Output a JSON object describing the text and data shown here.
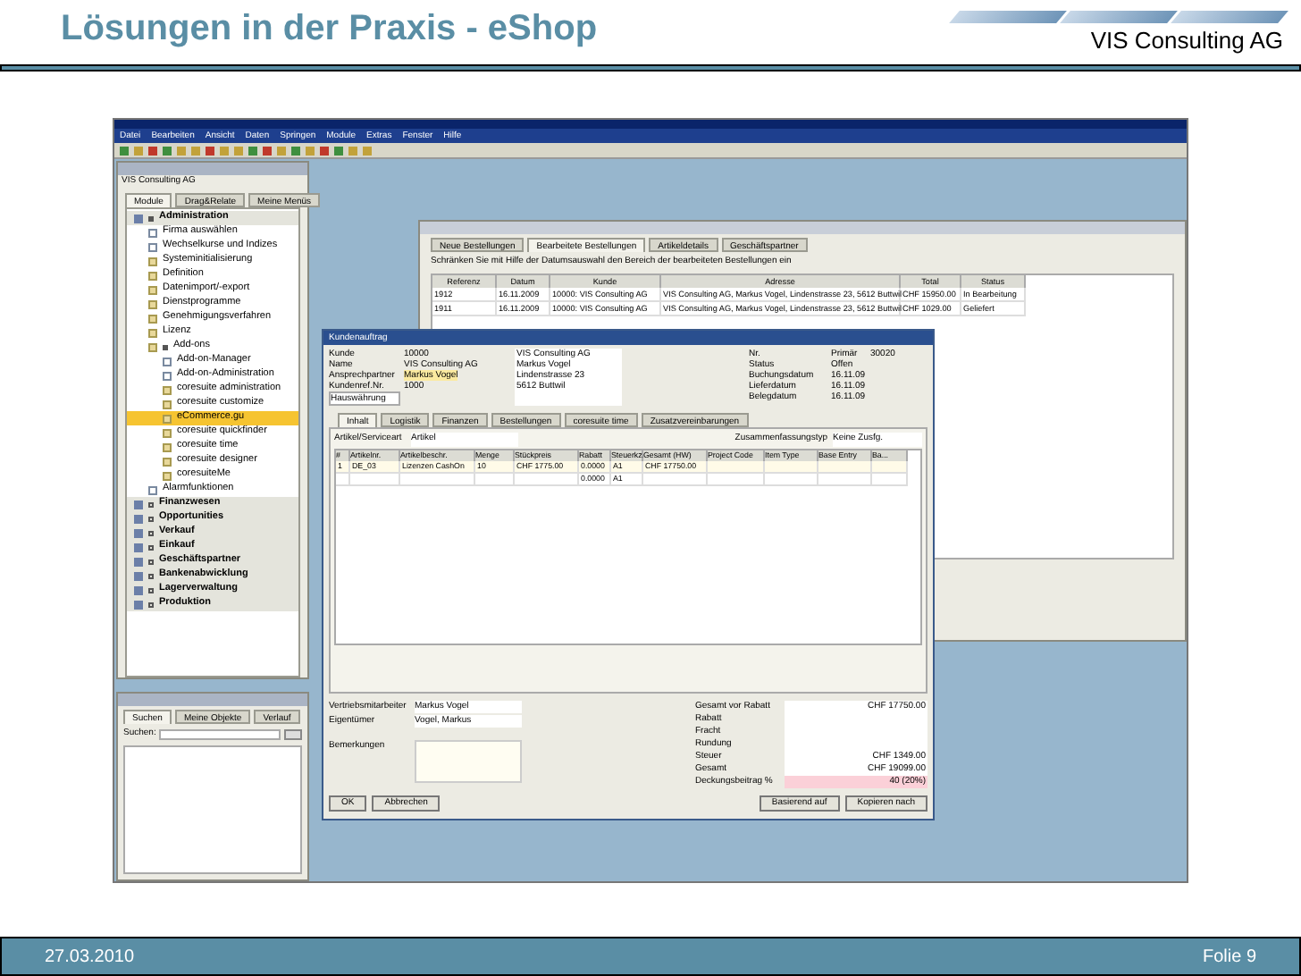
{
  "slide": {
    "title": "Lösungen in der Praxis - eShop",
    "company": "VIS Consulting AG",
    "date": "27.03.2010",
    "page": "Folie 9"
  },
  "app": {
    "menu": [
      "Datei",
      "Bearbeiten",
      "Ansicht",
      "Daten",
      "Springen",
      "Module",
      "Extras",
      "Fenster",
      "Hilfe"
    ],
    "navigator": {
      "company": "VIS Consulting AG",
      "tabs": [
        {
          "label": "Module",
          "selected": true
        },
        {
          "label": "Drag&Relate",
          "selected": false
        },
        {
          "label": "Meine Menüs",
          "selected": false
        }
      ],
      "items": [
        {
          "label": "Administration",
          "kind": "module",
          "selected": false,
          "expanded": true,
          "children": [
            {
              "label": "Firma auswählen",
              "kind": "form",
              "selected": false
            },
            {
              "label": "Wechselkurse und Indizes",
              "kind": "form",
              "selected": false
            },
            {
              "label": "Systeminitialisierung",
              "kind": "folder",
              "selected": false
            },
            {
              "label": "Definition",
              "kind": "folder",
              "selected": false
            },
            {
              "label": "Datenimport/-export",
              "kind": "folder",
              "selected": false
            },
            {
              "label": "Dienstprogramme",
              "kind": "folder",
              "selected": false
            },
            {
              "label": "Genehmigungsverfahren",
              "kind": "folder",
              "selected": false
            },
            {
              "label": "Lizenz",
              "kind": "folder",
              "selected": false
            },
            {
              "label": "Add-ons",
              "kind": "folder",
              "selected": false,
              "expanded": true,
              "children": [
                {
                  "label": "Add-on-Manager",
                  "kind": "form",
                  "selected": false
                },
                {
                  "label": "Add-on-Administration",
                  "kind": "form",
                  "selected": false
                },
                {
                  "label": "coresuite administration",
                  "kind": "folder",
                  "selected": false
                },
                {
                  "label": "coresuite customize",
                  "kind": "folder",
                  "selected": false
                },
                {
                  "label": "eCommerce.gu",
                  "kind": "folder",
                  "selected": true
                },
                {
                  "label": "coresuite quickfinder",
                  "kind": "folder",
                  "selected": false
                },
                {
                  "label": "coresuite time",
                  "kind": "folder",
                  "selected": false
                },
                {
                  "label": "coresuite designer",
                  "kind": "folder",
                  "selected": false
                },
                {
                  "label": "coresuiteMe",
                  "kind": "folder",
                  "selected": false
                }
              ]
            },
            {
              "label": "Alarmfunktionen",
              "kind": "form",
              "selected": false
            }
          ]
        },
        {
          "label": "Finanzwesen",
          "kind": "module",
          "selected": false,
          "expanded": false
        },
        {
          "label": "Opportunities",
          "kind": "module",
          "selected": false,
          "expanded": false
        },
        {
          "label": "Verkauf",
          "kind": "module",
          "selected": false,
          "expanded": false
        },
        {
          "label": "Einkauf",
          "kind": "module",
          "selected": false,
          "expanded": false
        },
        {
          "label": "Geschäftspartner",
          "kind": "module",
          "selected": false,
          "expanded": false
        },
        {
          "label": "Bankenabwicklung",
          "kind": "module",
          "selected": false,
          "expanded": false
        },
        {
          "label": "Lagerverwaltung",
          "kind": "module",
          "selected": false,
          "expanded": false
        },
        {
          "label": "Produktion",
          "kind": "module",
          "selected": false,
          "expanded": false
        }
      ]
    },
    "finder": {
      "tabs": [
        {
          "label": "Suchen",
          "selected": true
        },
        {
          "label": "Meine Objekte",
          "selected": false
        },
        {
          "label": "Verlauf",
          "selected": false
        }
      ],
      "search_label": "Suchen:"
    },
    "ecommerce": {
      "tabs": [
        {
          "label": "Neue Bestellungen",
          "selected": false
        },
        {
          "label": "Bearbeitete Bestellungen",
          "selected": true
        },
        {
          "label": "Artikeldetails",
          "selected": false
        },
        {
          "label": "Geschäftspartner",
          "selected": false
        }
      ],
      "hint": "Schränken Sie mit Hilfe der Datumsauswahl den Bereich der bearbeiteten Bestellungen ein",
      "columns": [
        "Referenz",
        "Datum",
        "Kunde",
        "Adresse",
        "Total",
        "Status"
      ],
      "rows": [
        [
          "1912",
          "16.11.2009",
          "10000: VIS Consulting AG",
          "VIS Consulting AG, Markus Vogel, Lindenstrasse 23, 5612 Buttwil",
          "CHF 15950.00",
          "In Bearbeitung"
        ],
        [
          "1911",
          "16.11.2009",
          "10000: VIS Consulting AG",
          "VIS Consulting AG, Markus Vogel, Lindenstrasse 23, 5612 Buttwil",
          "CHF 1029.00",
          "Geliefert"
        ]
      ]
    },
    "order": {
      "title": "Kundenauftrag",
      "left_fields": [
        {
          "label": "Kunde",
          "value": "10000"
        },
        {
          "label": "Name",
          "value": "VIS Consulting AG"
        },
        {
          "label": "Ansprechpartner",
          "value": "Markus Vogel"
        },
        {
          "label": "Kundenref.Nr.",
          "value": "1000"
        }
      ],
      "currency": "Hauswährung",
      "address": [
        "VIS Consulting AG",
        "Markus Vogel",
        "Lindenstrasse 23",
        "5612 Buttwil"
      ],
      "right_fields": [
        {
          "label": "Nr.",
          "value": "30020",
          "extra": "Primär"
        },
        {
          "label": "Status",
          "value": "Offen"
        },
        {
          "label": "Buchungsdatum",
          "value": "16.11.09"
        },
        {
          "label": "Lieferdatum",
          "value": "16.11.09"
        },
        {
          "label": "Belegdatum",
          "value": "16.11.09"
        }
      ],
      "tabs": [
        {
          "label": "Inhalt",
          "selected": true
        },
        {
          "label": "Logistik",
          "selected": false
        },
        {
          "label": "Finanzen",
          "selected": false
        },
        {
          "label": "Bestellungen",
          "selected": false
        },
        {
          "label": "coresuite time",
          "selected": false
        },
        {
          "label": "Zusatzvereinbarungen",
          "selected": false
        }
      ],
      "type_label": "Artikel/Serviceart",
      "type_value": "Artikel",
      "summary_label": "Zusammenfassungstyp",
      "summary_value": "Keine Zusfg.",
      "columns": [
        "#",
        "Artikelnr.",
        "Artikelbeschr.",
        "Menge",
        "Stückpreis",
        "Rabatt",
        "Steuerkz.",
        "Gesamt (HW)",
        "Project Code",
        "Item Type",
        "Base Entry",
        "Ba..."
      ],
      "rows": [
        [
          "1",
          "DE_03",
          "Lizenzen CashOn",
          "10",
          "CHF 1775.00",
          "0.0000",
          "A1",
          "CHF 17750.00",
          "",
          "",
          "",
          ""
        ],
        [
          "",
          "",
          "",
          "",
          "",
          "0.0000",
          "A1",
          "",
          "",
          "",
          "",
          ""
        ]
      ],
      "sales_label": "Vertriebsmitarbeiter",
      "sales_value": "Markus Vogel",
      "owner_label": "Eigentümer",
      "owner_value": "Vogel, Markus",
      "remarks_label": "Bemerkungen",
      "totals": [
        {
          "label": "Gesamt vor Rabatt",
          "value": "CHF 17750.00"
        },
        {
          "label": "Rabatt"
        },
        {
          "label": "Fracht"
        },
        {
          "label": "Rundung"
        },
        {
          "label": "Steuer",
          "value": "CHF 1349.00"
        },
        {
          "label": "Gesamt",
          "value": "CHF 19099.00"
        },
        {
          "label": "Deckungsbeitrag %",
          "value": "40 (20%)"
        }
      ],
      "buttons_left": [
        "OK",
        "Abbrechen"
      ],
      "buttons_right": [
        "Basierend auf",
        "Kopieren nach"
      ]
    }
  }
}
